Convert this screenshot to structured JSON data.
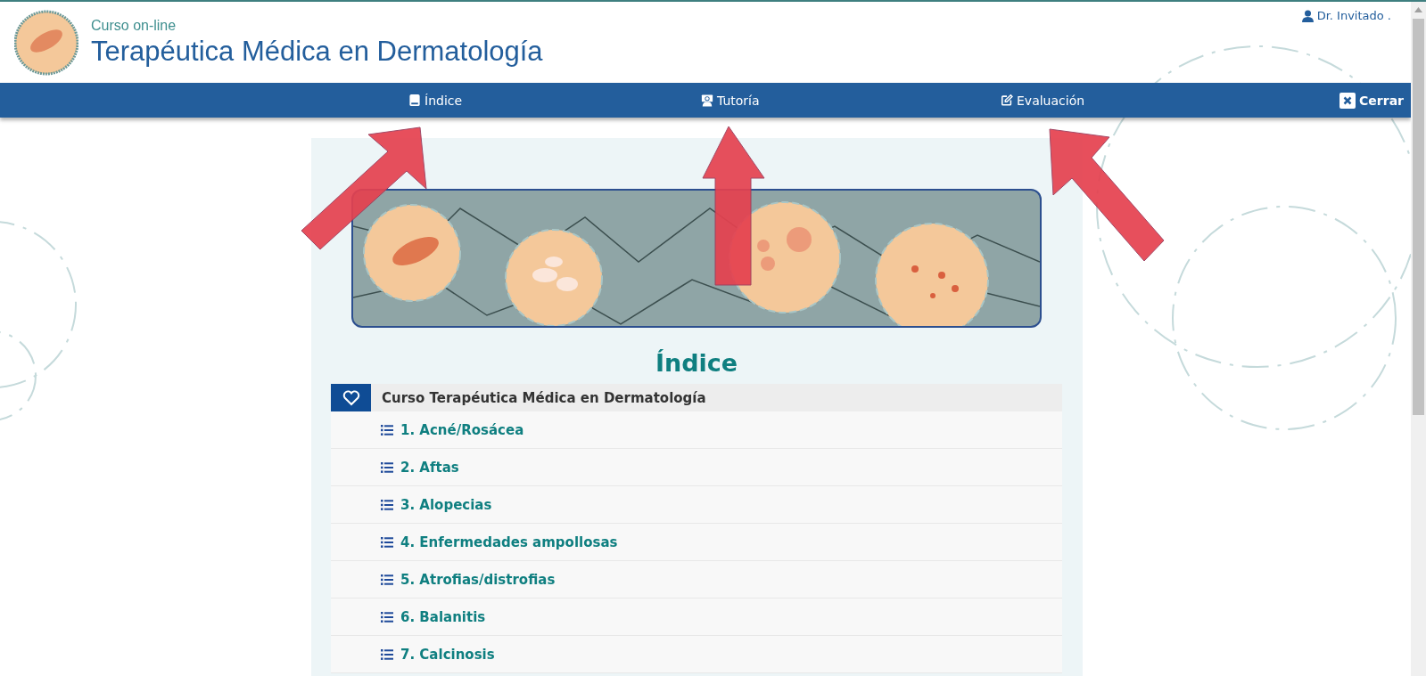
{
  "header": {
    "subtitle": "Curso on-line",
    "title": "Terapéutica Médica en Dermatología",
    "user": "Dr. Invitado ."
  },
  "nav": {
    "items": [
      {
        "label": "Índice"
      },
      {
        "label": "Tutoría"
      },
      {
        "label": "Evaluación"
      }
    ],
    "close": "Cerrar"
  },
  "index": {
    "title": "Índice",
    "course": "Curso Terapéutica Médica en Dermatología",
    "chapters": [
      {
        "label": "1. Acné/Rosácea"
      },
      {
        "label": "2. Aftas"
      },
      {
        "label": "3. Alopecias"
      },
      {
        "label": "4. Enfermedades ampollosas"
      },
      {
        "label": "5. Atrofias/distrofias"
      },
      {
        "label": "6. Balanitis"
      },
      {
        "label": "7. Calcinosis"
      }
    ]
  }
}
